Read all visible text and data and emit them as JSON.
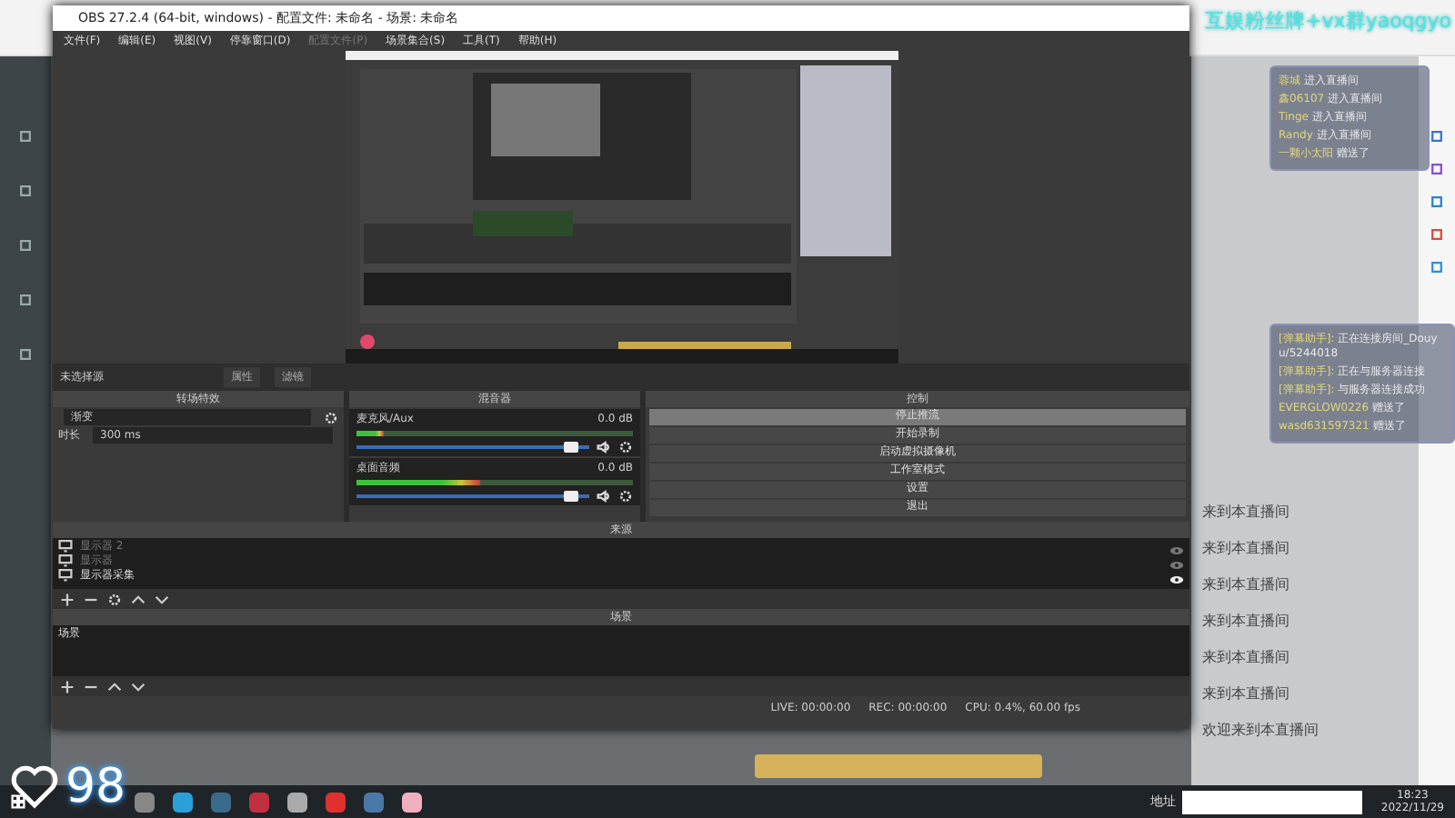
{
  "obs": {
    "title": "OBS 27.2.4 (64-bit, windows) - 配置文件: 未命名 - 场景: 未命名",
    "menu": [
      {
        "label": "文件(F)",
        "disabled": false
      },
      {
        "label": "编辑(E)",
        "disabled": false
      },
      {
        "label": "视图(V)",
        "disabled": false
      },
      {
        "label": "停靠窗口(D)",
        "disabled": false
      },
      {
        "label": "配置文件(P)",
        "disabled": true
      },
      {
        "label": "场景集合(S)",
        "disabled": false
      },
      {
        "label": "工具(T)",
        "disabled": false
      },
      {
        "label": "帮助(H)",
        "disabled": false
      }
    ],
    "source_toolbar": {
      "label": "未选择源",
      "buttons": [
        "属性",
        "滤镜"
      ]
    },
    "transitions": {
      "title": "转场特效",
      "value": "渐变",
      "duration_label": "时长",
      "duration": "300 ms"
    },
    "mixer": {
      "title": "混音器",
      "channels": [
        {
          "name": "麦克风/Aux",
          "reading": "0.0 dB",
          "meter": {
            "level": 0.1
          },
          "volume": {
            "level": 0.95
          }
        },
        {
          "name": "桌面音频",
          "reading": "0.0 dB",
          "meter": {
            "level": 0.45
          },
          "volume": {
            "level": 0.95
          }
        }
      ]
    },
    "controls": {
      "title": "控制",
      "buttons": [
        {
          "label": "停止推流",
          "highlighted": true
        },
        {
          "label": "开始录制",
          "highlighted": false
        },
        {
          "label": "启动虚拟摄像机",
          "highlighted": false
        },
        {
          "label": "工作室模式",
          "highlighted": false
        },
        {
          "label": "设置",
          "highlighted": false
        },
        {
          "label": "退出",
          "highlighted": false
        }
      ]
    },
    "sources": {
      "title": "来源",
      "items": [
        {
          "name": "显示器 2",
          "visible": false
        },
        {
          "name": "显示器",
          "visible": false
        },
        {
          "name": "显示器采集",
          "visible": true
        }
      ]
    },
    "scenes": {
      "title": "场景",
      "items": [
        {
          "name": "场景"
        }
      ]
    },
    "status": {
      "live": "LIVE: 00:00:00",
      "rec": "REC: 00:00:00",
      "cpu": "CPU: 0.4%, 60.00 fps"
    }
  },
  "overlay_text": "互娱粉丝牌+vx群yaoqgyo",
  "chat_overlay": [
    {
      "user": "蓉城",
      "text": "进入直播间"
    },
    {
      "user": "鑫06107",
      "text": "进入直播间"
    },
    {
      "user": "Tinge",
      "text": "进入直播间"
    },
    {
      "user": "Randy",
      "text": "进入直播间"
    },
    {
      "user": "一颗小太阳",
      "text": "赠送了"
    }
  ],
  "assistant_overlay": [
    {
      "user": "[弹幕助手]:",
      "text": "正在连接房间_Douyu/5244018"
    },
    {
      "user": "[弹幕助手]:",
      "text": "正在与服务器连接"
    },
    {
      "user": "[弹幕助手]:",
      "text": "与服务器连接成功"
    },
    {
      "user": "EVERGLOW0226",
      "text": "赠送了"
    },
    {
      "user": "wasd631597321",
      "text": "赠送了"
    }
  ],
  "chat_lines": [
    "来到本直播间",
    "来到本直播间",
    "来到本直播间",
    "来到本直播间",
    "来到本直播间",
    "来到本直播间",
    "欢迎来到本直播间"
  ],
  "heart_count": "98",
  "taskbar": {
    "address_label": "地址",
    "time": "18:23",
    "date": "2022/11/29"
  }
}
